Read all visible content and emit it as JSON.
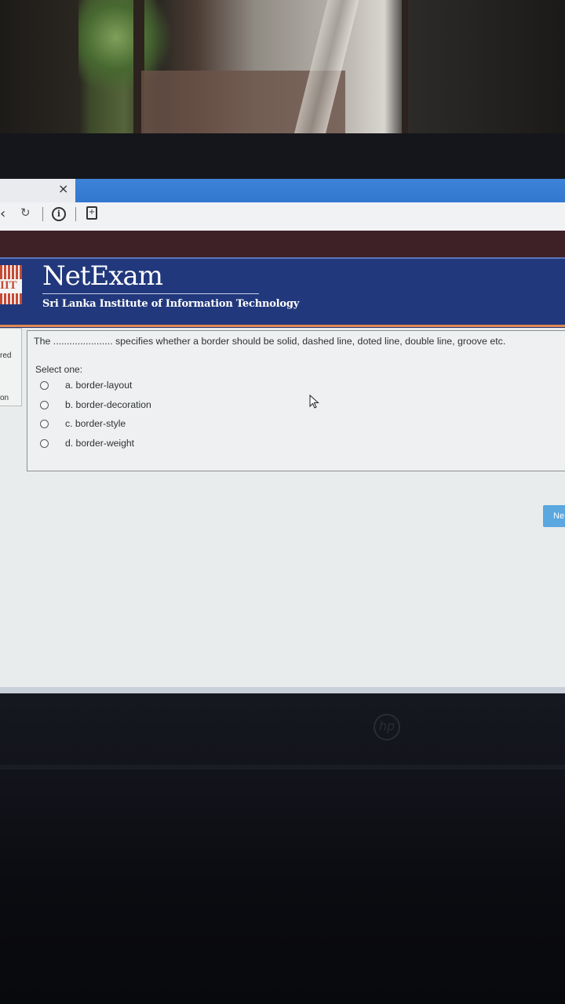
{
  "browser": {
    "tab_close": "×",
    "nav_back": "‹",
    "nav_reload": "↻",
    "info_icon": "i",
    "page_icon": "+"
  },
  "header": {
    "logo_text": "IIT",
    "brand": "NetExam",
    "tagline": "Sri Lanka Institute of Information Technology"
  },
  "sidebar": {
    "frag1": "red",
    "frag2": "on"
  },
  "question": {
    "text": "The ...................... specifies whether a border should be solid, dashed line, doted line, double line, groove etc.",
    "prompt": "Select one:",
    "options": [
      "a. border-layout",
      "b. border-decoration",
      "c. border-style",
      "d. border-weight"
    ]
  },
  "navigation": {
    "next_label": "Ne"
  },
  "device": {
    "brand_logo": "hp"
  },
  "colors": {
    "header_bg": "#22387c",
    "accent_rule": "#e08a52",
    "next_button": "#5ba7e0",
    "maroon_band": "#3d2127"
  }
}
